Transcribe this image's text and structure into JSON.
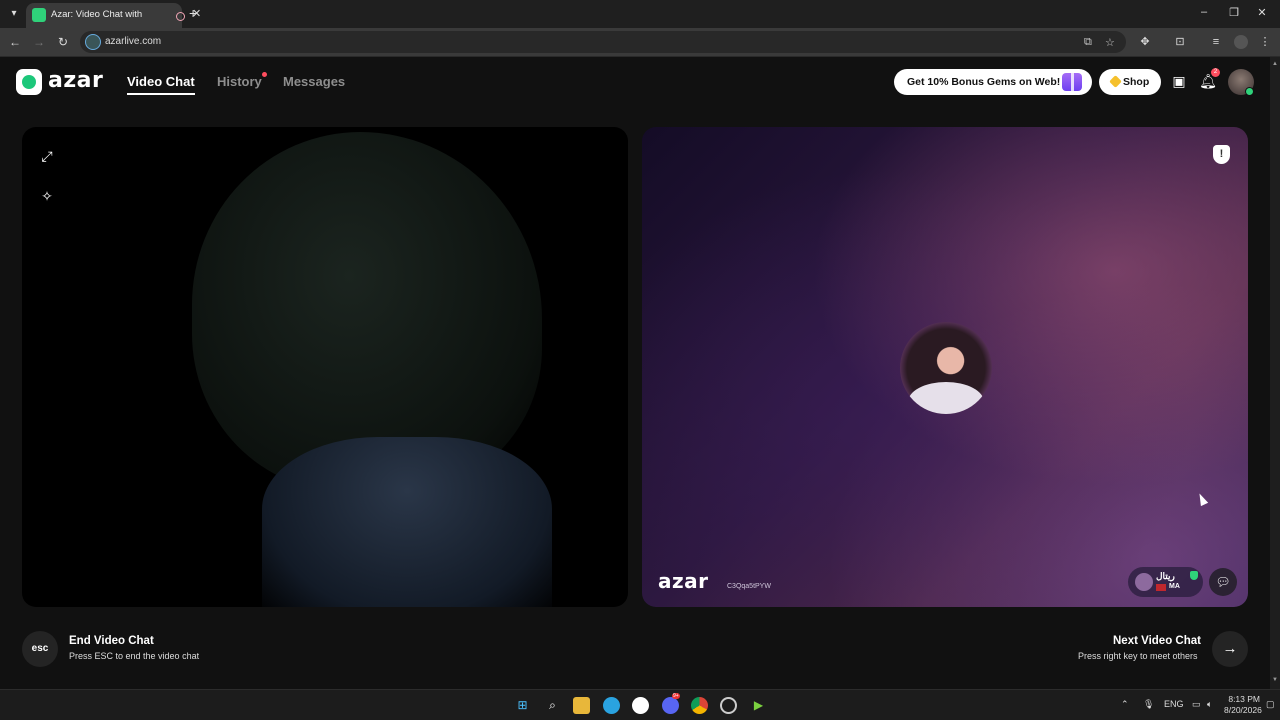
{
  "browser": {
    "tab_title": "Azar: Video Chat with New",
    "url": "azarlive.com",
    "tab_menu_icon": "chevron-down-icon",
    "new_tab_icon": "plus-icon",
    "minimize_glyph": "–",
    "maximize_glyph": "❐",
    "close_glyph": "✕"
  },
  "site": {
    "logo_text": "azar",
    "nav": {
      "video_chat": "Video Chat",
      "history": "History",
      "messages": "Messages"
    },
    "bonus_button": "Get 10% Bonus Gems on Web!",
    "shop_button": "Shop",
    "notification_count": "2"
  },
  "partner": {
    "watermark": "azar",
    "watermark_id": "C3Qqa5tPYW",
    "name": "ريتال",
    "country": "MA"
  },
  "controls": {
    "esc_label": "esc",
    "end_title": "End Video Chat",
    "end_hint": "Press ESC to end the video chat",
    "next_title": "Next Video Chat",
    "next_hint": "Press right key to meet others",
    "next_arrow": "→"
  },
  "taskbar": {
    "discord_badge": "9+",
    "language": "ENG",
    "time": "8:13 PM",
    "date": "8/20/2026"
  },
  "colors": {
    "brand_green": "#1cc77a",
    "alert_red": "#ff4d5e",
    "gem_yellow": "#f5c02c",
    "gift_purple": "#6d3ff0"
  }
}
